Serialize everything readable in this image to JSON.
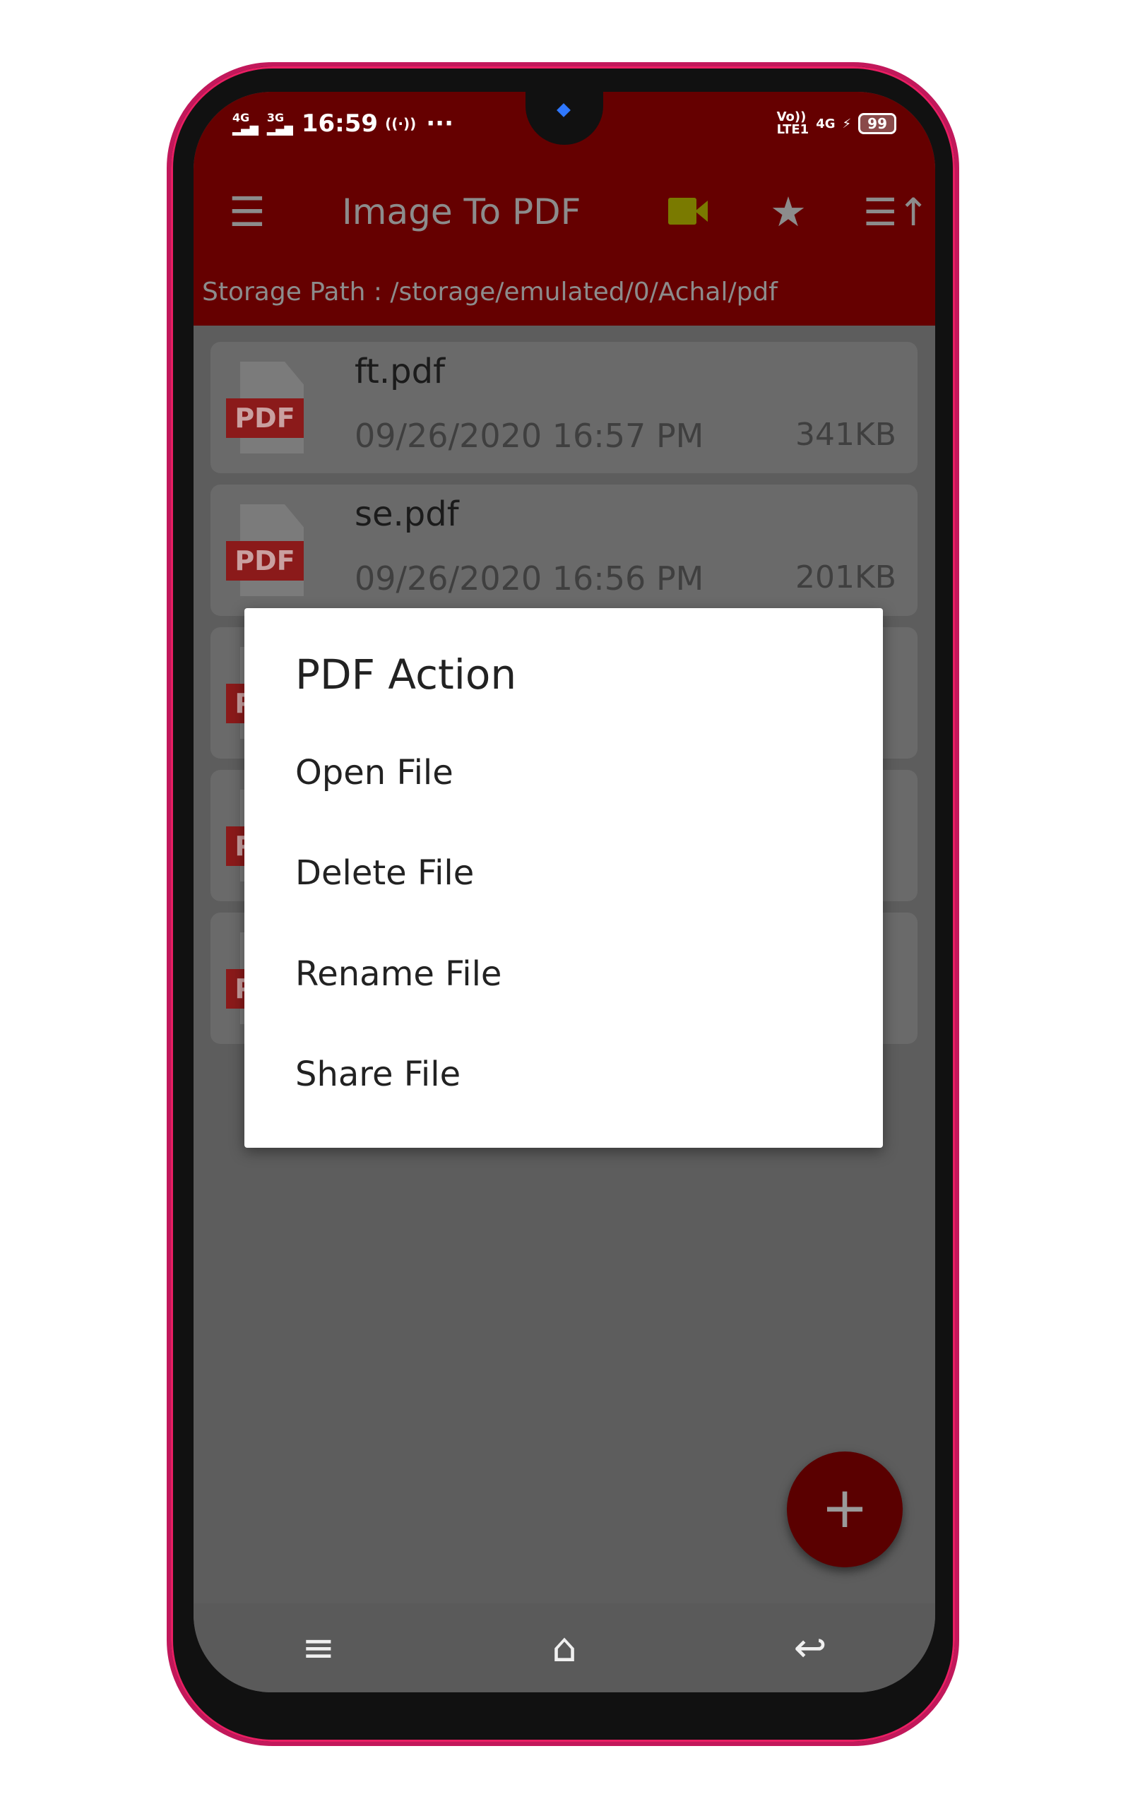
{
  "status_bar": {
    "sim1": "4G",
    "sim2": "3G",
    "time": "16:59",
    "hotspot": "((·))",
    "more": "···",
    "volte": "Vo))\nLTE1",
    "net": "4G",
    "battery": "99"
  },
  "toolbar": {
    "title": "Image To PDF",
    "menu_icon": "hamburger-icon",
    "video_icon": "video-camera-icon",
    "star_icon": "star-icon",
    "sort_icon": "sort-icon"
  },
  "storage_path": "Storage Path : /storage/emulated/0/Achal/pdf",
  "files": [
    {
      "name": "ft.pdf",
      "date": "09/26/2020 16:57 PM",
      "size": "341KB"
    },
    {
      "name": "se.pdf",
      "date": "09/26/2020 16:56 PM",
      "size": "201KB"
    }
  ],
  "pdf_badge": "PDF",
  "dialog": {
    "title": "PDF Action",
    "items": [
      "Open File",
      "Delete File",
      "Rename File",
      "Share File"
    ]
  },
  "fab": "+",
  "nav": {
    "menu": "≡",
    "home": "⌂",
    "back": "↩"
  },
  "colors": {
    "appbar": "#650000",
    "fab": "#5a0000",
    "video_icon": "#7a7a00"
  }
}
